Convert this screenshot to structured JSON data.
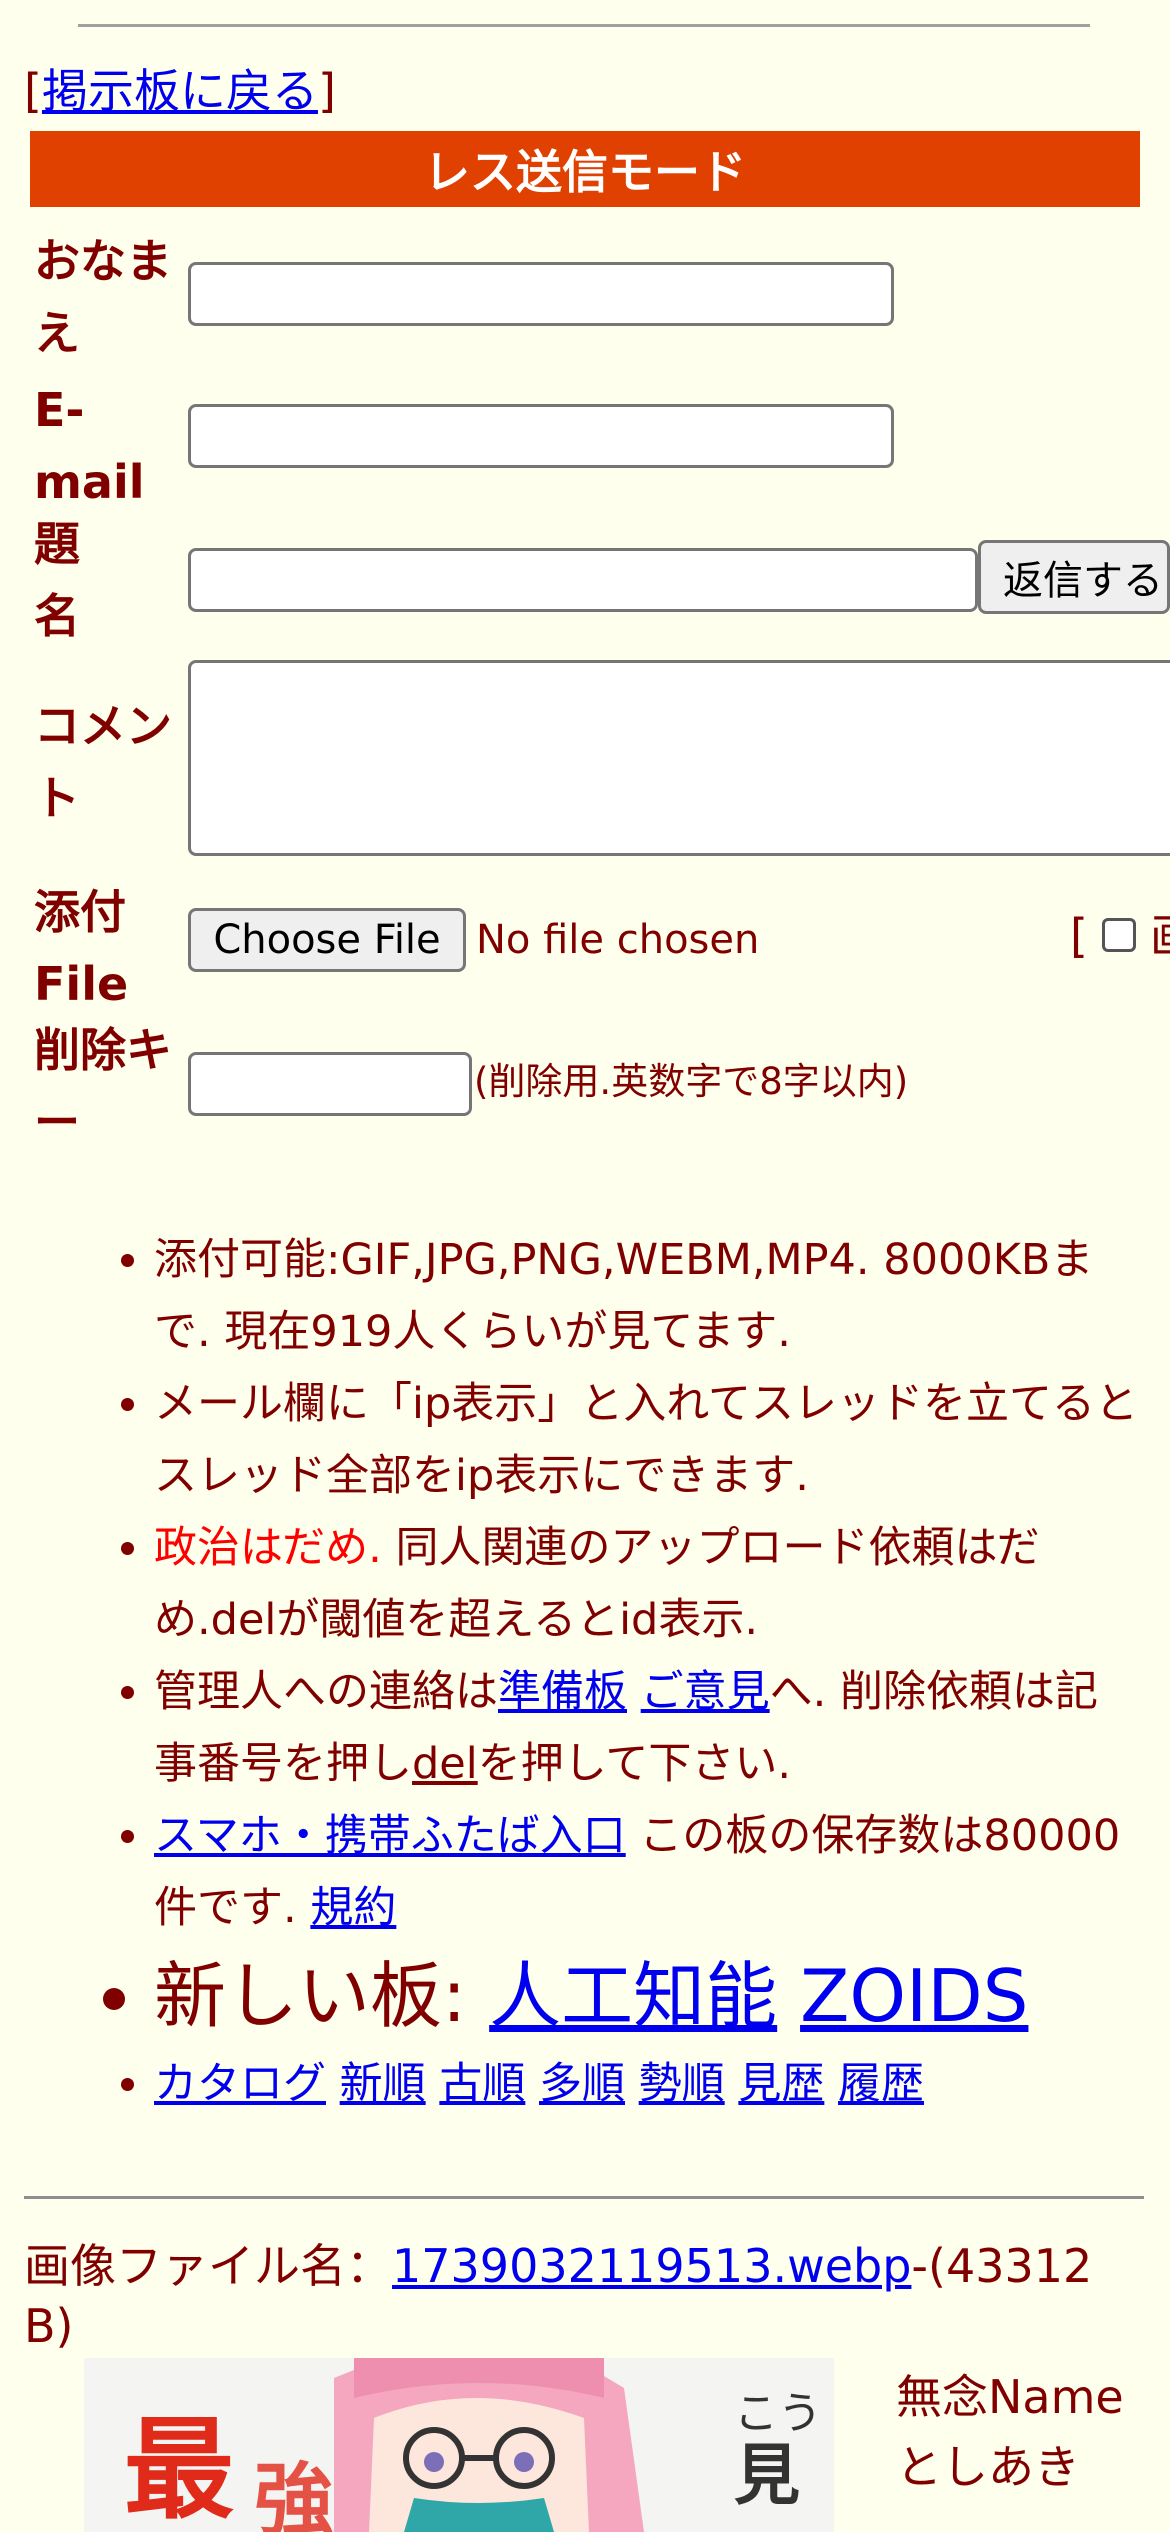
{
  "nav": {
    "bracket_open": "[",
    "back_link": "掲示板に戻る",
    "bracket_close": "]"
  },
  "form": {
    "mode_title": "レス送信モード",
    "name_label_1": "おなま",
    "name_label_2": "え",
    "email_label_1": "E-",
    "email_label_2": "mail",
    "subject_label_1": "題",
    "subject_label_2": "名",
    "submit_label": "返信する",
    "comment_label_1": "コメン",
    "comment_label_2": "ト",
    "file_label_1": "添付",
    "file_label_2": "File",
    "choose_file_label": "Choose File",
    "no_file_text": "No file chosen",
    "image_check_bracket": "[",
    "image_check_label": "画",
    "delkey_label_1": "削除キ",
    "delkey_label_2": "ー",
    "delkey_note": "(削除用.英数字で8字以内)"
  },
  "rules": {
    "r1": "添付可能:GIF,JPG,PNG,WEBM,MP4. 8000KBまで. 現在919人くらいが見てます.",
    "r2": "メール欄に「ip表示」と入れてスレッドを立てるとスレッド全部をip表示にできます.",
    "r3_red": "政治はだめ.",
    "r3_rest": " 同人関連のアップロード依頼はだめ.delが閾値を超えるとid表示.",
    "r4_a": "管理人への連絡は",
    "r4_link1": "準備板",
    "r4_link2": "ご意見",
    "r4_b": "へ. 削除依頼は記事番号を押し",
    "r4_link3": "del",
    "r4_c": "を押して下さい.",
    "r5_link1": "スマホ・携帯ふたば入口",
    "r5_text": " この板の保存数は80000件です. ",
    "r5_link2": "規約",
    "r6_text": "新しい板: ",
    "r6_link1": "人工知能",
    "r6_link2": "ZOIDS",
    "sort_links": [
      "カタログ",
      "新順",
      "古順",
      "多順",
      "勢順",
      "見歴",
      "履歴"
    ]
  },
  "post": {
    "image_prefix": "画像ファイル名：",
    "image_file": "1739032119513.webp",
    "image_size": "-(43312 B)",
    "name_line_1": "無念Name",
    "name_line_2": "としあき"
  },
  "colors": {
    "background": "#ffffee",
    "text": "#800000",
    "mode_bar": "#e04000",
    "link": "#0000ee",
    "warning": "#ff0000"
  }
}
